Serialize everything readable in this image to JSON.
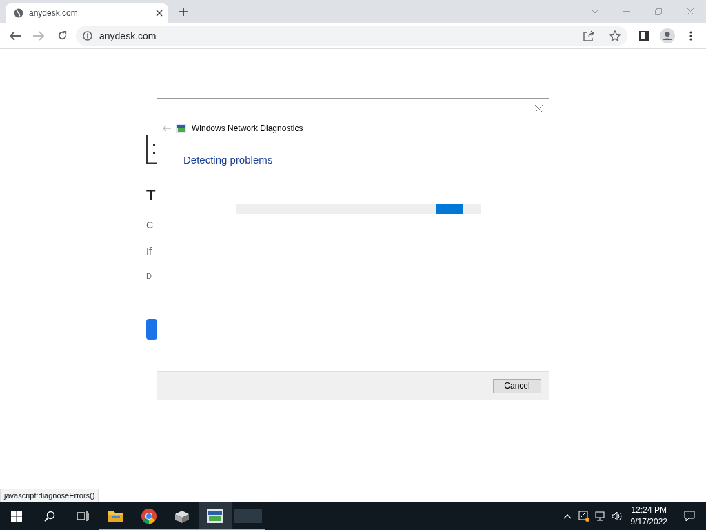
{
  "browser": {
    "tab": {
      "title": "anydesk.com",
      "selected": true
    },
    "address": "anydesk.com",
    "status_url": "javascript:diagnoseErrors()"
  },
  "page": {
    "fragments": [
      "T",
      "C",
      "If",
      "D"
    ]
  },
  "dialog": {
    "title": "Windows Network Diagnostics",
    "heading": "Detecting problems",
    "progress": {
      "indeterminate": true
    },
    "cancel": "Cancel"
  },
  "taskbar": {
    "apps": [
      {
        "kind": "explorer",
        "running": true,
        "selected": false
      },
      {
        "kind": "chrome",
        "running": true,
        "selected": false
      },
      {
        "kind": "box",
        "running": true,
        "selected": false
      },
      {
        "kind": "diagnostics",
        "running": true,
        "selected": true
      },
      {
        "kind": "blank",
        "running": true,
        "selected": false
      }
    ],
    "time": "12:24 PM",
    "date": "9/17/2022"
  }
}
